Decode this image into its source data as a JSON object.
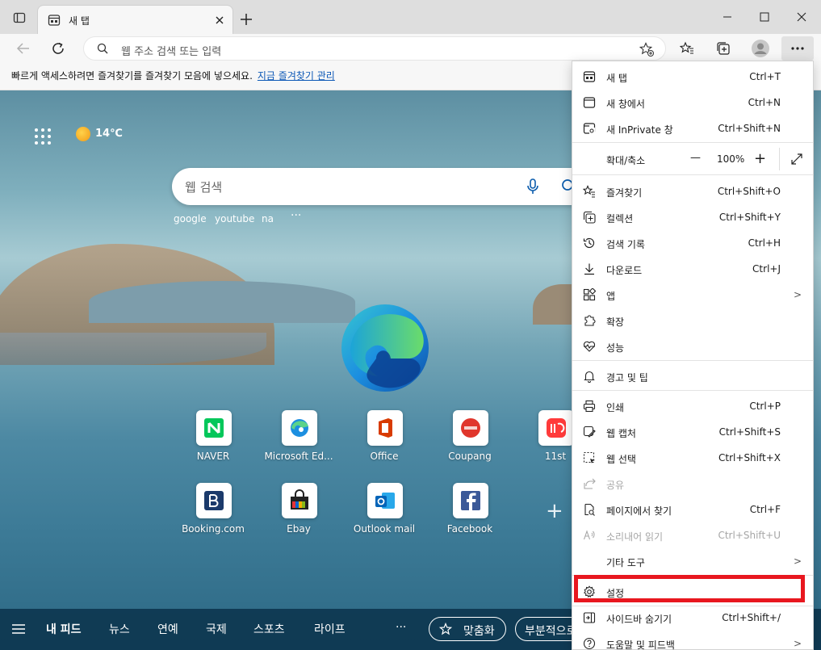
{
  "tab": {
    "title": "새 탭"
  },
  "address": {
    "placeholder": "웹 주소 검색 또는 입력"
  },
  "favorites_bar": {
    "message": "빠르게 액세스하려면 즐겨찾기를 즐겨찾기 모음에 넣으세요.",
    "link": "지금 즐겨찾기 관리"
  },
  "weather": {
    "temp": "14℃"
  },
  "search": {
    "placeholder": "웹 검색",
    "suggestions": [
      "google",
      "youtube",
      "na"
    ]
  },
  "tiles_row1": [
    "NAVER",
    "Microsoft Ed...",
    "Office",
    "Coupang",
    "11st"
  ],
  "tiles_row2": [
    "Booking.com",
    "Ebay",
    "Outlook mail",
    "Facebook"
  ],
  "feed": {
    "tabs": [
      "내 피드",
      "뉴스",
      "연예",
      "국제",
      "스포츠",
      "라이프"
    ],
    "more": "···",
    "personalize": "맞춤화",
    "partial": "부분적으로"
  },
  "menu": {
    "new_tab": {
      "label": "새 탭",
      "shortcut": "Ctrl+T"
    },
    "new_window": {
      "label": "새 창에서",
      "shortcut": "Ctrl+N"
    },
    "inprivate": {
      "label": "새 InPrivate 창",
      "shortcut": "Ctrl+Shift+N"
    },
    "zoom": {
      "label": "확대/축소",
      "minus": "—",
      "value": "100%",
      "plus": "+"
    },
    "favorites": {
      "label": "즐겨찾기",
      "shortcut": "Ctrl+Shift+O"
    },
    "collections": {
      "label": "컬렉션",
      "shortcut": "Ctrl+Shift+Y"
    },
    "history": {
      "label": "검색 기록",
      "shortcut": "Ctrl+H"
    },
    "downloads": {
      "label": "다운로드",
      "shortcut": "Ctrl+J"
    },
    "apps": {
      "label": "앱"
    },
    "extensions": {
      "label": "확장"
    },
    "performance": {
      "label": "성능"
    },
    "alerts": {
      "label": "경고 및 팁"
    },
    "print": {
      "label": "인쇄",
      "shortcut": "Ctrl+P"
    },
    "capture": {
      "label": "웹 캡처",
      "shortcut": "Ctrl+Shift+S"
    },
    "select": {
      "label": "웹 선택",
      "shortcut": "Ctrl+Shift+X"
    },
    "share": {
      "label": "공유"
    },
    "find": {
      "label": "페이지에서 찾기",
      "shortcut": "Ctrl+F"
    },
    "read_aloud": {
      "label": "소리내어 읽기",
      "shortcut": "Ctrl+Shift+U"
    },
    "more_tools": {
      "label": "기타 도구"
    },
    "settings": {
      "label": "설정"
    },
    "hide_sidebar": {
      "label": "사이드바 숨기기",
      "shortcut": "Ctrl+Shift+/"
    },
    "help": {
      "label": "도움말 및 피드백"
    }
  }
}
